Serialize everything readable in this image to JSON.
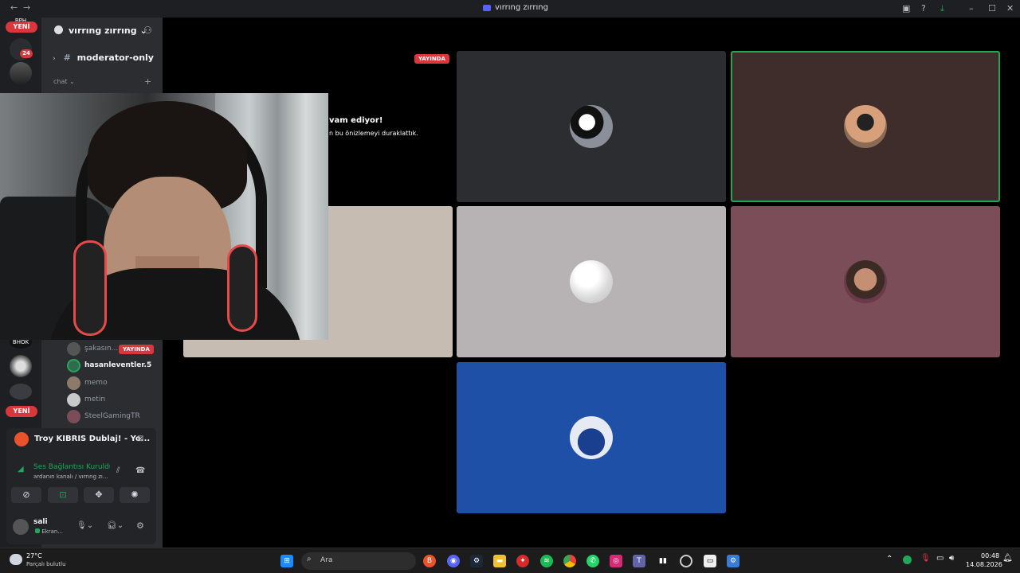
{
  "window": {
    "title": "vırrıng zırrıng",
    "nav_back": "←",
    "nav_forward": "→"
  },
  "rail": {
    "new_badge_top": "YENİ",
    "new_badge_bottom": "YENİ",
    "mention_count": "24",
    "server_label_top": "BPH",
    "server_label_mid": "BHOK"
  },
  "server": {
    "name": "vırrıng zırrıng",
    "channel_moderator": "moderator-only",
    "category_chat": "chat"
  },
  "stream_preview": {
    "live_label": "YAYINDA",
    "title_fragment": "vam ediyor!",
    "subtitle_fragment": "n bu önizlemeyi duraklattık."
  },
  "voice_members": [
    {
      "name": "şakasın...",
      "live": "YAYINDA",
      "color": "#949ba4"
    },
    {
      "name": "hasanleventler.5",
      "color": "#f2f3f5"
    },
    {
      "name": "memo",
      "color": "#949ba4"
    },
    {
      "name": "metin",
      "color": "#949ba4"
    },
    {
      "name": "SteelGamingTR",
      "color": "#949ba4"
    }
  ],
  "activity": {
    "title": "Troy KIBRIS Dublaj! - Yo..."
  },
  "voice_status": {
    "status": "Ses Bağlantısı Kuruldu",
    "channel": "ardanın kanalı / vırrıng zı..."
  },
  "user": {
    "name": "sali",
    "status": "Ekran..."
  },
  "taskbar": {
    "temperature": "27°C",
    "weather": "Parçalı bulutlu",
    "search_placeholder": "Ara",
    "time": "00:48",
    "date": "14.08.2026"
  },
  "colors": {
    "tile_dark": "#2b2d31",
    "tile_brown": "#3f2d2b",
    "tile_beige": "#c6bcb1",
    "tile_gray": "#b7b2b3",
    "tile_mauve": "#7a4d59",
    "tile_blue": "#1f50a8",
    "speaking": "#23a55a",
    "live": "#da373c"
  }
}
